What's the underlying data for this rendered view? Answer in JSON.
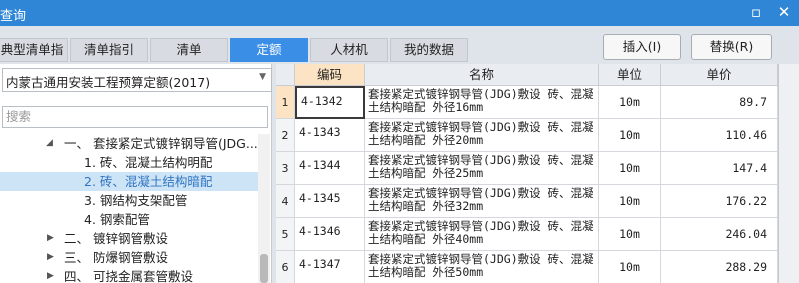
{
  "window": {
    "title": "查询"
  },
  "tabs": [
    "典型清单指引",
    "清单指引",
    "清单",
    "定额",
    "人材机",
    "我的数据"
  ],
  "active_tab": "定额",
  "actions": {
    "insert_label": "插入(I)",
    "replace_label": "替换(R)"
  },
  "left": {
    "quota_library": "内蒙古通用安装工程预算定额(2017)",
    "search_placeholder": "搜索",
    "tree": [
      {
        "label": "一、 套接紧定式镀锌钢导管(JDG...",
        "expanded": true
      },
      {
        "label": "1. 砖、混凝土结构明配"
      },
      {
        "label": "2. 砖、混凝土结构暗配",
        "selected": true
      },
      {
        "label": "3. 钢结构支架配管"
      },
      {
        "label": "4. 钢索配管"
      },
      {
        "label": "二、 镀锌钢管敷设",
        "expanded": false
      },
      {
        "label": "三、 防爆钢管敷设",
        "expanded": false
      },
      {
        "label": "四、 可挠金属套管敷设",
        "expanded": false
      }
    ]
  },
  "grid": {
    "columns": {
      "code": "编码",
      "name": "名称",
      "unit": "单位",
      "price": "单价"
    },
    "rows": [
      {
        "no": "1",
        "code": "4-1342",
        "name": "套接紧定式镀锌钢导管(JDG)敷设 砖、混凝土结构暗配 外径16mm",
        "unit": "10m",
        "price": "89.7"
      },
      {
        "no": "2",
        "code": "4-1343",
        "name": "套接紧定式镀锌钢导管(JDG)敷设 砖、混凝土结构暗配 外径20mm",
        "unit": "10m",
        "price": "110.46"
      },
      {
        "no": "3",
        "code": "4-1344",
        "name": "套接紧定式镀锌钢导管(JDG)敷设 砖、混凝土结构暗配 外径25mm",
        "unit": "10m",
        "price": "147.4"
      },
      {
        "no": "4",
        "code": "4-1345",
        "name": "套接紧定式镀锌钢导管(JDG)敷设 砖、混凝土结构暗配 外径32mm",
        "unit": "10m",
        "price": "176.22"
      },
      {
        "no": "5",
        "code": "4-1346",
        "name": "套接紧定式镀锌钢导管(JDG)敷设 砖、混凝土结构暗配 外径40mm",
        "unit": "10m",
        "price": "246.04"
      },
      {
        "no": "6",
        "code": "4-1347",
        "name": "套接紧定式镀锌钢导管(JDG)敷设 砖、混凝土结构暗配 外径50mm",
        "unit": "10m",
        "price": "288.29"
      }
    ]
  }
}
